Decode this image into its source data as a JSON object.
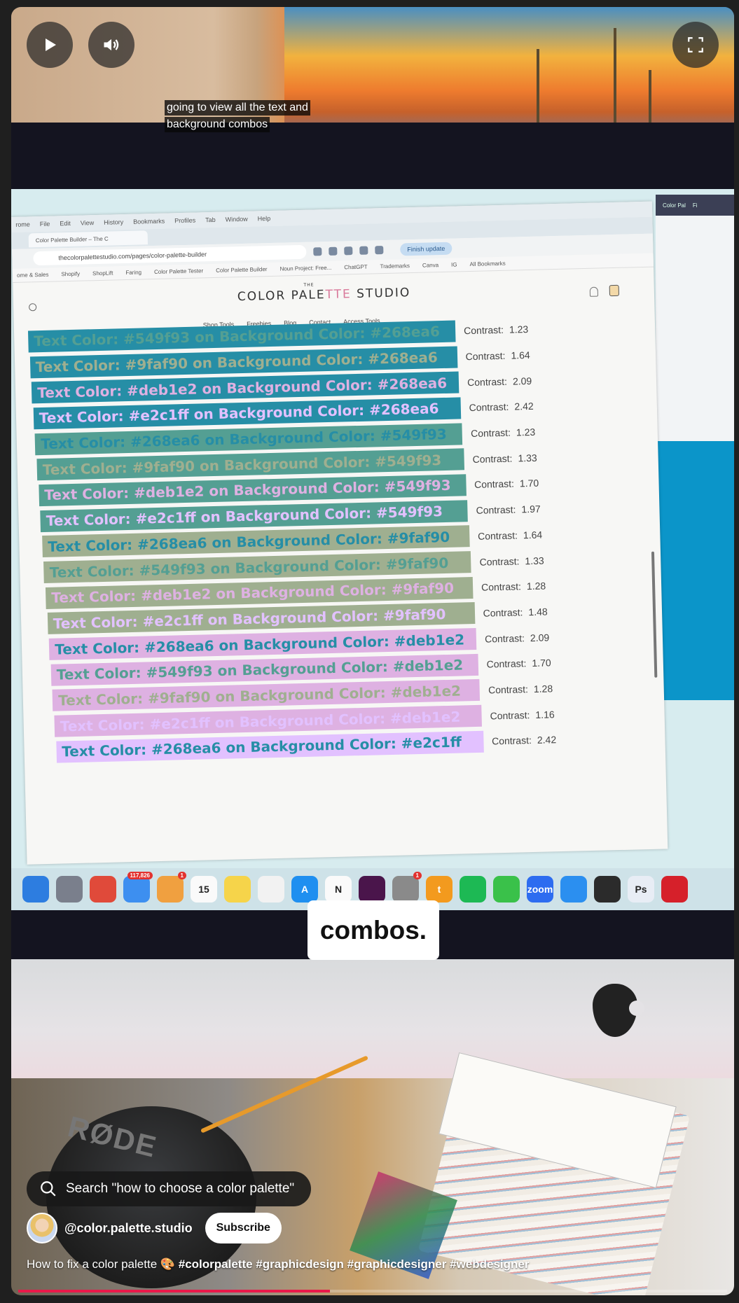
{
  "player": {
    "controls": {
      "play_icon": "play-icon",
      "volume_icon": "volume-icon",
      "fullscreen_icon": "fullscreen-icon"
    },
    "caption_top": [
      "going to view all the text and",
      "background combos"
    ],
    "caption_big": "combos.",
    "progress_fraction": 0.44,
    "progress_color": "#e9194a"
  },
  "browser": {
    "menubar": [
      "rome",
      "File",
      "Edit",
      "View",
      "History",
      "Bookmarks",
      "Profiles",
      "Tab",
      "Window",
      "Help"
    ],
    "tab_label": "Color Palette Builder – The C",
    "url": "thecolorpalettestudio.com/pages/color-palette-builder",
    "finish_update": "Finish update",
    "bookmarks": [
      "ome & Sales",
      "Shopify",
      "ShopLift",
      "Faring",
      "Color Palette Tester",
      "Color Palette Builder",
      "Noun Project: Free...",
      "ChatGPT",
      "Trademarks",
      "Canva",
      "IG",
      "All Bookmarks"
    ],
    "site_logo": {
      "the": "THE",
      "part1": "COLOR PALE",
      "accent": "TTE",
      "part2": " STUDIO"
    },
    "nav": [
      "Shop Tools",
      "Freebies",
      "Blog",
      "Contact",
      "Access Tools"
    ],
    "contrast_label": "Contrast:",
    "combos": [
      {
        "text": "Text Color: #549f93 on Background Color: #268ea6",
        "fg": "#549f93",
        "bg": "#268ea6",
        "contrast": "1.23"
      },
      {
        "text": "Text Color: #9faf90 on Background Color: #268ea6",
        "fg": "#9faf90",
        "bg": "#268ea6",
        "contrast": "1.64"
      },
      {
        "text": "Text Color: #deb1e2 on Background Color: #268ea6",
        "fg": "#deb1e2",
        "bg": "#268ea6",
        "contrast": "2.09"
      },
      {
        "text": "Text Color: #e2c1ff on Background Color: #268ea6",
        "fg": "#e2c1ff",
        "bg": "#268ea6",
        "contrast": "2.42"
      },
      {
        "text": "Text Color: #268ea6 on Background Color: #549f93",
        "fg": "#268ea6",
        "bg": "#549f93",
        "contrast": "1.23"
      },
      {
        "text": "Text Color: #9faf90 on Background Color: #549f93",
        "fg": "#9faf90",
        "bg": "#549f93",
        "contrast": "1.33"
      },
      {
        "text": "Text Color: #deb1e2 on Background Color: #549f93",
        "fg": "#deb1e2",
        "bg": "#549f93",
        "contrast": "1.70"
      },
      {
        "text": "Text Color: #e2c1ff on Background Color: #549f93",
        "fg": "#e2c1ff",
        "bg": "#549f93",
        "contrast": "1.97"
      },
      {
        "text": "Text Color: #268ea6 on Background Color: #9faf90",
        "fg": "#268ea6",
        "bg": "#9faf90",
        "contrast": "1.64"
      },
      {
        "text": "Text Color: #549f93 on Background Color: #9faf90",
        "fg": "#549f93",
        "bg": "#9faf90",
        "contrast": "1.33"
      },
      {
        "text": "Text Color: #deb1e2 on Background Color: #9faf90",
        "fg": "#deb1e2",
        "bg": "#9faf90",
        "contrast": "1.28"
      },
      {
        "text": "Text Color: #e2c1ff on Background Color: #9faf90",
        "fg": "#e2c1ff",
        "bg": "#9faf90",
        "contrast": "1.48"
      },
      {
        "text": "Text Color: #268ea6 on Background Color: #deb1e2",
        "fg": "#268ea6",
        "bg": "#deb1e2",
        "contrast": "2.09"
      },
      {
        "text": "Text Color: #549f93 on Background Color: #deb1e2",
        "fg": "#549f93",
        "bg": "#deb1e2",
        "contrast": "1.70"
      },
      {
        "text": "Text Color: #9faf90 on Background Color: #deb1e2",
        "fg": "#9faf90",
        "bg": "#deb1e2",
        "contrast": "1.28"
      },
      {
        "text": "Text Color: #e2c1ff on Background Color: #deb1e2",
        "fg": "#e2c1ff",
        "bg": "#deb1e2",
        "contrast": "1.16"
      },
      {
        "text": "Text Color: #268ea6 on Background Color: #e2c1ff",
        "fg": "#268ea6",
        "bg": "#e2c1ff",
        "contrast": "2.42"
      }
    ]
  },
  "side_window": {
    "tabs": [
      "Color Pal",
      "Fi"
    ]
  },
  "dock": [
    {
      "name": "finder",
      "bg": "#2d7de0",
      "label": ""
    },
    {
      "name": "launchpad",
      "bg": "#7a7f8c",
      "label": ""
    },
    {
      "name": "chrome",
      "bg": "#e04a3a",
      "label": ""
    },
    {
      "name": "mail",
      "bg": "#3d8ff0",
      "label": "",
      "badge": "117,826"
    },
    {
      "name": "photos",
      "bg": "#f0a040",
      "label": "",
      "badge": "1"
    },
    {
      "name": "calendar",
      "bg": "#fafafa",
      "label": "15"
    },
    {
      "name": "notes",
      "bg": "#f6d44a",
      "label": ""
    },
    {
      "name": "freeform",
      "bg": "#f2f2f2",
      "label": ""
    },
    {
      "name": "app-store",
      "bg": "#1f8ff0",
      "label": "A"
    },
    {
      "name": "notion",
      "bg": "#fafafa",
      "label": "N"
    },
    {
      "name": "slack",
      "bg": "#4a154b",
      "label": ""
    },
    {
      "name": "settings",
      "bg": "#8a8a8a",
      "label": "",
      "badge": "1"
    },
    {
      "name": "tasks",
      "bg": "#f39a1e",
      "label": "t"
    },
    {
      "name": "spotify",
      "bg": "#1db954",
      "label": ""
    },
    {
      "name": "messages",
      "bg": "#3ac14a",
      "label": ""
    },
    {
      "name": "zoom",
      "bg": "#2d6cf0",
      "label": "zoom"
    },
    {
      "name": "safari",
      "bg": "#2b8ff0",
      "label": ""
    },
    {
      "name": "figma",
      "bg": "#2b2b2b",
      "label": ""
    },
    {
      "name": "photoshop",
      "bg": "#e8edf5",
      "label": "Ps"
    },
    {
      "name": "acrobat",
      "bg": "#d6202a",
      "label": ""
    }
  ],
  "overlay": {
    "search_icon": "search-icon",
    "search_text": "Search \"how to choose a color palette\"",
    "channel_handle": "@color.palette.studio",
    "subscribe_label": "Subscribe",
    "title_plain": "How to fix a color palette 🎨 ",
    "title_tags": "#colorpalette #graphicdesign #graphicdesigner #webdesigner"
  },
  "props": {
    "mic_brand": "RØDE"
  }
}
